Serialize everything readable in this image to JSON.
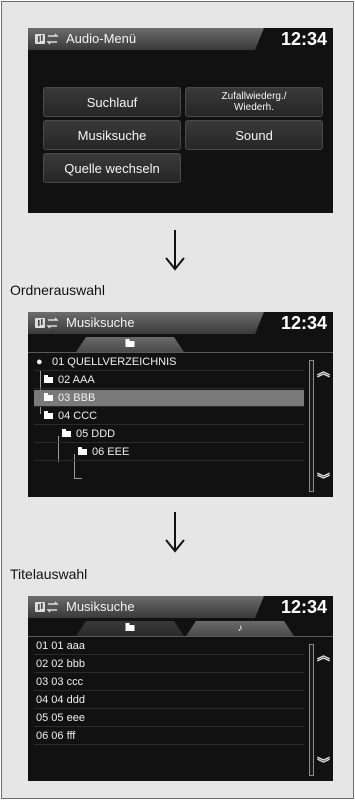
{
  "screens": {
    "audio_menu": {
      "title": "Audio-Menü",
      "clock": "12:34",
      "buttons": {
        "search": "Suchlauf",
        "shuffle_repeat": "Zufallwiederg./\nWiederh.",
        "music_search": "Musiksuche",
        "sound": "Sound",
        "change_source": "Quelle wechseln"
      }
    },
    "folder_select": {
      "section_label": "Ordnerauswahl",
      "title": "Musiksuche",
      "clock": "12:34",
      "folders": [
        {
          "label": "01 QUELLVERZEICHNIS",
          "selected": false
        },
        {
          "label": "02 AAA",
          "selected": false
        },
        {
          "label": "03 BBB",
          "selected": true
        },
        {
          "label": "04 CCC",
          "selected": false
        },
        {
          "label": "05 DDD",
          "selected": false
        },
        {
          "label": "06 EEE",
          "selected": false
        }
      ]
    },
    "track_select": {
      "section_label": "Titelauswahl",
      "title": "Musiksuche",
      "clock": "12:34",
      "tracks": [
        "01 01 aaa",
        "02 02 bbb",
        "03 03 ccc",
        "04 04 ddd",
        "05 05 eee",
        "06 06 fff"
      ]
    }
  },
  "icons": {
    "source": "audio-source-icon",
    "folder_tab": "folder-icon",
    "music_tab": "music-note-icon",
    "scroll_up": "scroll-up-icon",
    "scroll_down": "scroll-down-icon",
    "flow_arrow": "arrow-down-icon"
  },
  "colors": {
    "screen_background": "#111111",
    "selection": "#7a7a7a",
    "frame_background": "#e6e6e6"
  }
}
